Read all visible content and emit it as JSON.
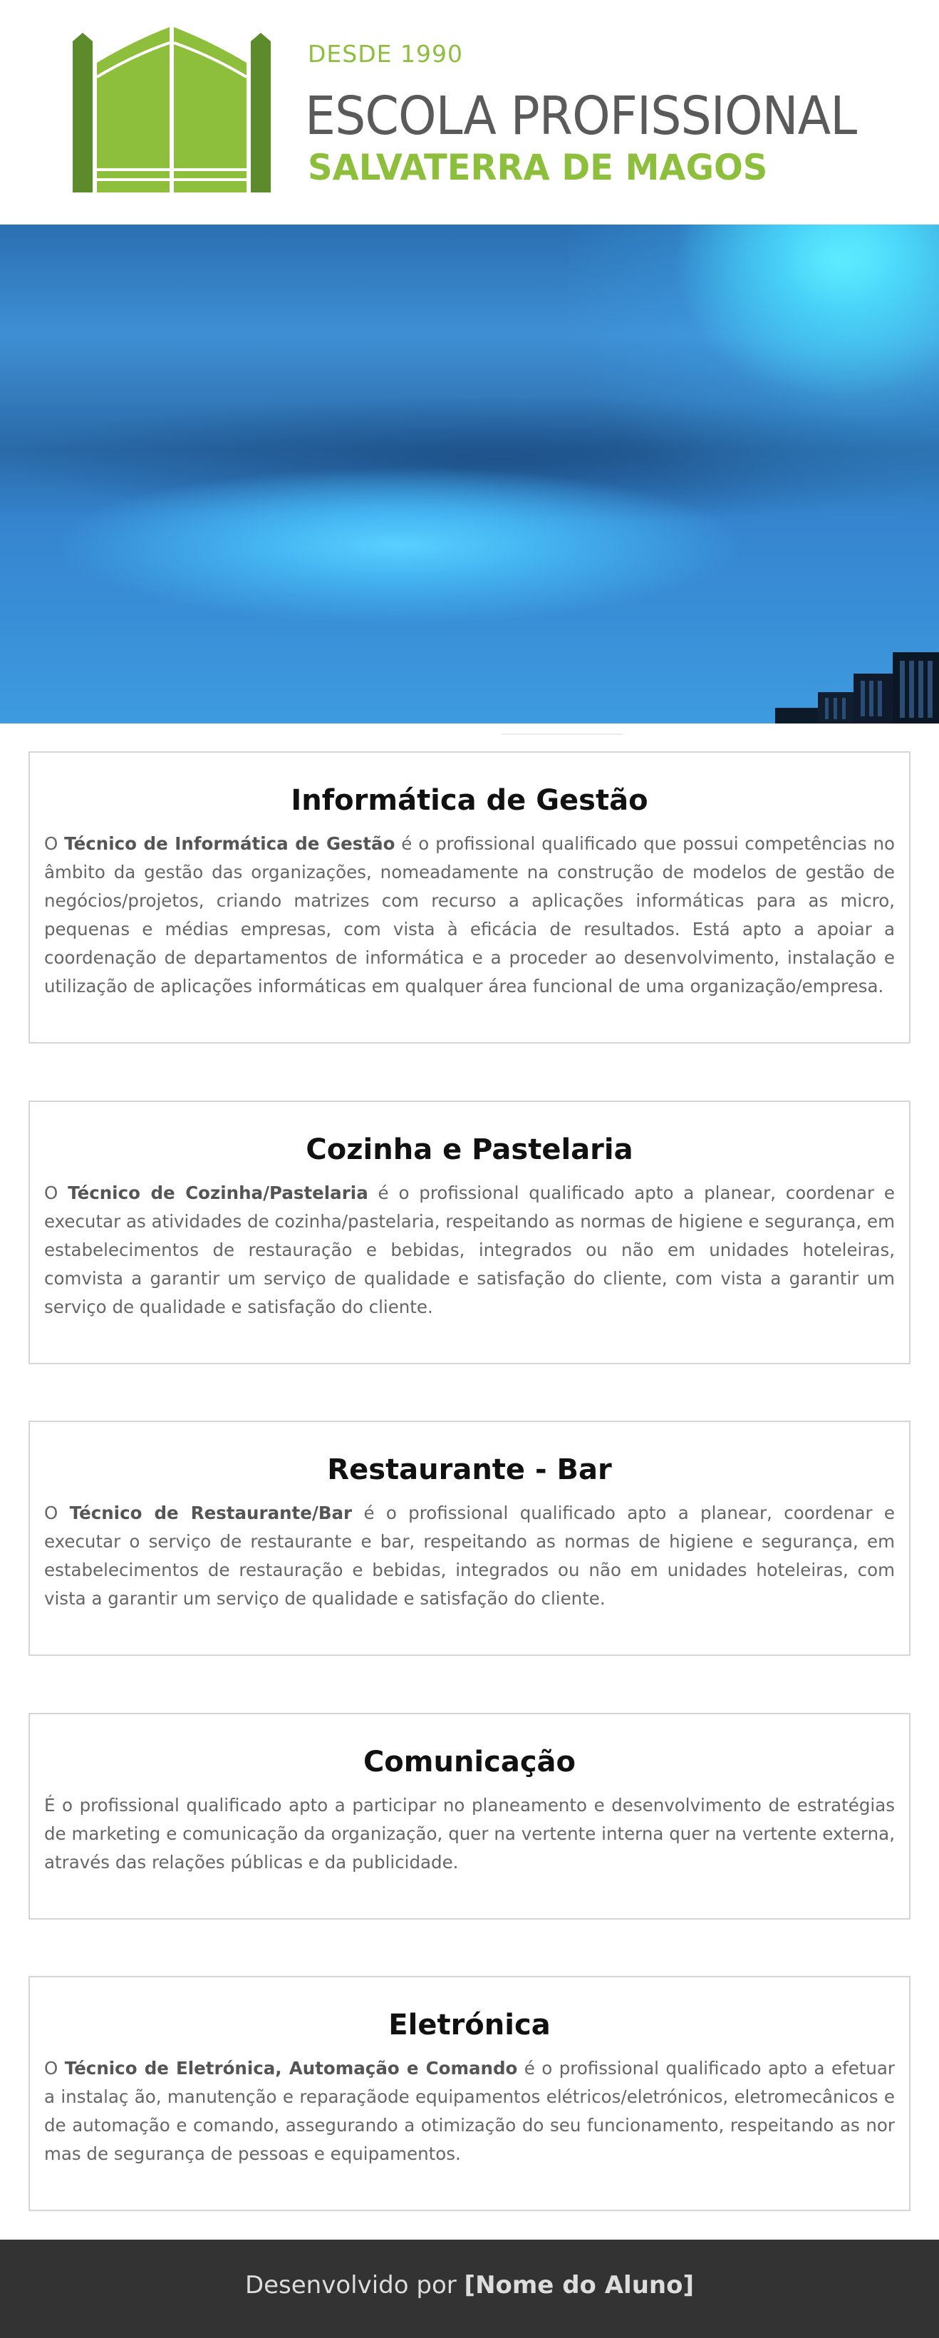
{
  "logo": {
    "since": "DESDE 1990",
    "name": "ESCOLA PROFISSIONAL",
    "place": "SALVATERRA DE MAGOS",
    "icon": "gate-icon",
    "colors": {
      "green": "#8dbf3c",
      "dark_green": "#5d8a2b",
      "gray": "#5a5a5a"
    }
  },
  "hero": {
    "image": "blue-server-room-banner"
  },
  "courses": [
    {
      "title": "Informática de Gestão",
      "lead": "O ",
      "bold": "Técnico de Informática de Gestão",
      "text": " é o profissional qualificado que possui competências no âmbito da gestão das organizações, nomeadamente na construção de modelos de gestão de negócios/projetos, criando matrizes com recurso a aplicações informáticas para as micro, pequenas e médias empresas, com vista à eficácia de resultados. Está apto a apoiar a coordenação de departamentos de informática e a proceder ao desenvolvimento, instalação e utilização de aplicações informáticas em qualquer área funcional de uma organização/empresa."
    },
    {
      "title": "Cozinha e Pastelaria",
      "lead": "O ",
      "bold": "Técnico de Cozinha/Pastelaria",
      "text": " é o profissional qualificado apto a planear, coordenar e executar as atividades de cozinha/pastelaria, respeitando as normas de higiene e segurança, em estabelecimentos de restauração e bebidas, integrados ou não em unidades hoteleiras, comvista a garantir um serviço de qualidade e satisfação do cliente, com vista a garantir um serviço de qualidade e satisfação do cliente."
    },
    {
      "title": "Restaurante - Bar",
      "lead": "O ",
      "bold": "Técnico de Restaurante/Bar",
      "text": " é o profissional qualificado apto a planear, coordenar e executar o serviço de restaurante e bar, respeitando as normas de higiene e segurança, em estabelecimentos de restauração e bebidas, integrados ou não em unidades hoteleiras, com vista a garantir um serviço de qualidade e satisfação do cliente."
    },
    {
      "title": "Comunicação",
      "lead": "",
      "bold": "",
      "text": "É o profissional qualificado apto a participar no planeamento e desenvolvimento de estratégias de marketing e comunicação da organização, quer na vertente interna quer na vertente externa, através das relações públicas e da publicidade."
    },
    {
      "title": "Eletrónica",
      "lead": "O ",
      "bold": "Técnico de Eletrónica, Automação e Comando",
      "text": " é o profissional qualificado apto a efetuar a instalaç ão, manutenção e reparaçãode equipamentos elétricos/eletrónicos, eletromecânicos e de automação e comando, assegurando a otimização do seu funcionamento, respeitando as nor mas de segurança de pessoas e equipamentos."
    }
  ],
  "footer": {
    "prefix": "Desenvolvido por ",
    "author": "[Nome do Aluno]"
  }
}
